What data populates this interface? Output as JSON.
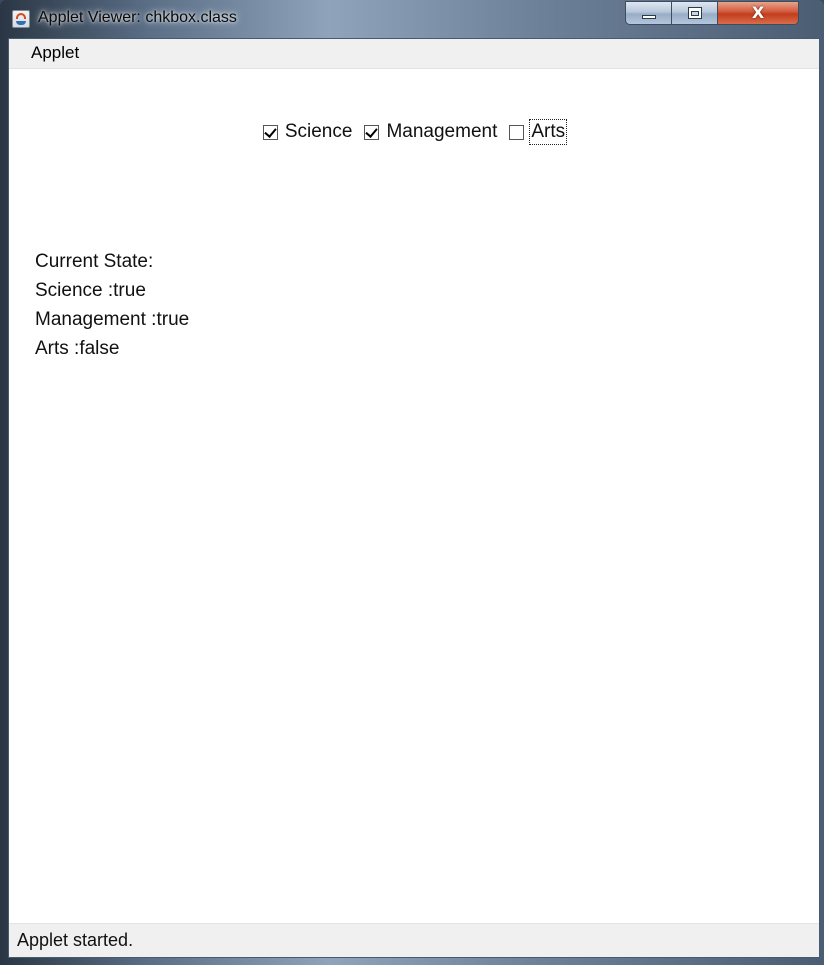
{
  "window": {
    "title": "Applet Viewer: chkbox.class",
    "app_icon": "java-icon",
    "close_glyph": "X"
  },
  "menubar": {
    "items": [
      {
        "label": "Applet"
      }
    ]
  },
  "checkboxes": [
    {
      "label": "Science",
      "checked": true
    },
    {
      "label": "Management",
      "checked": true
    },
    {
      "label": "Arts",
      "checked": false,
      "focused": true
    }
  ],
  "state": {
    "heading": "Current State:",
    "lines": [
      "Science :true",
      "Management :true",
      "Arts :false"
    ]
  },
  "status": {
    "text": "Applet started."
  }
}
